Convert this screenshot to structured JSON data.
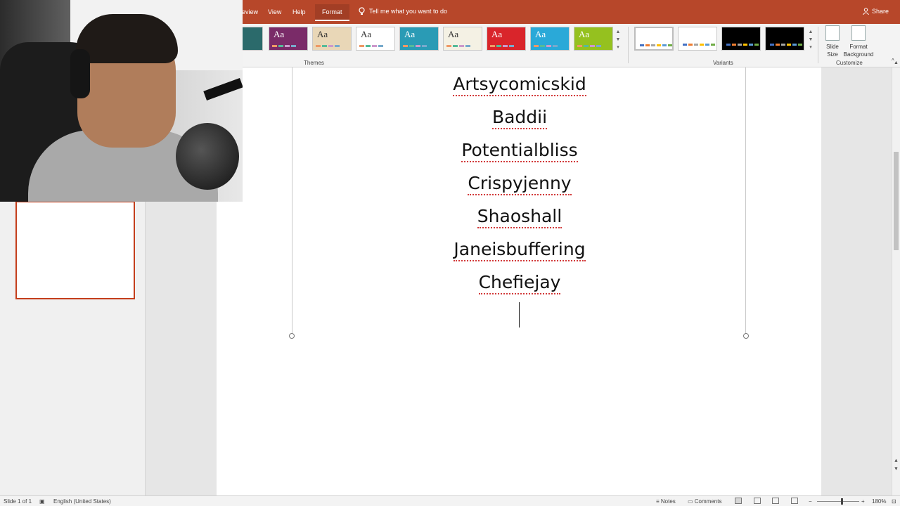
{
  "menu": {
    "items": [
      "eview",
      "View",
      "Help",
      "Format"
    ],
    "active": "Format",
    "tell_me": "Tell me what you want to do",
    "share": "Share"
  },
  "ribbon": {
    "themes_label": "Themes",
    "variants_label": "Variants",
    "customize_label": "Customize",
    "theme_glyph": "Aa",
    "slide_size": "Slide Size",
    "format_background": "Format Background",
    "theme_colors": [
      "#2b6a6b",
      "#7a2b68",
      "#e9d7b7",
      "#ffffff",
      "#2a9bb5",
      "#f4f1e4",
      "#d9252b",
      "#2aa9d8",
      "#95c11f"
    ],
    "variant_colors": [
      "#ffffff",
      "#ffffff",
      "#000000",
      "#000000"
    ]
  },
  "slide": {
    "names": [
      "Artsycomicskid",
      "Baddii",
      "Potentialbliss",
      "Crispyjenny",
      "Shaoshall",
      "Janeisbuffering",
      "Chefiejay"
    ]
  },
  "status": {
    "slide_of": "Slide 1 of 1",
    "language": "English (United States)",
    "notes": "Notes",
    "comments": "Comments",
    "zoom": "180%"
  },
  "colors": {
    "accent": "#b7472a",
    "spellcheck": "#d23a3a"
  }
}
